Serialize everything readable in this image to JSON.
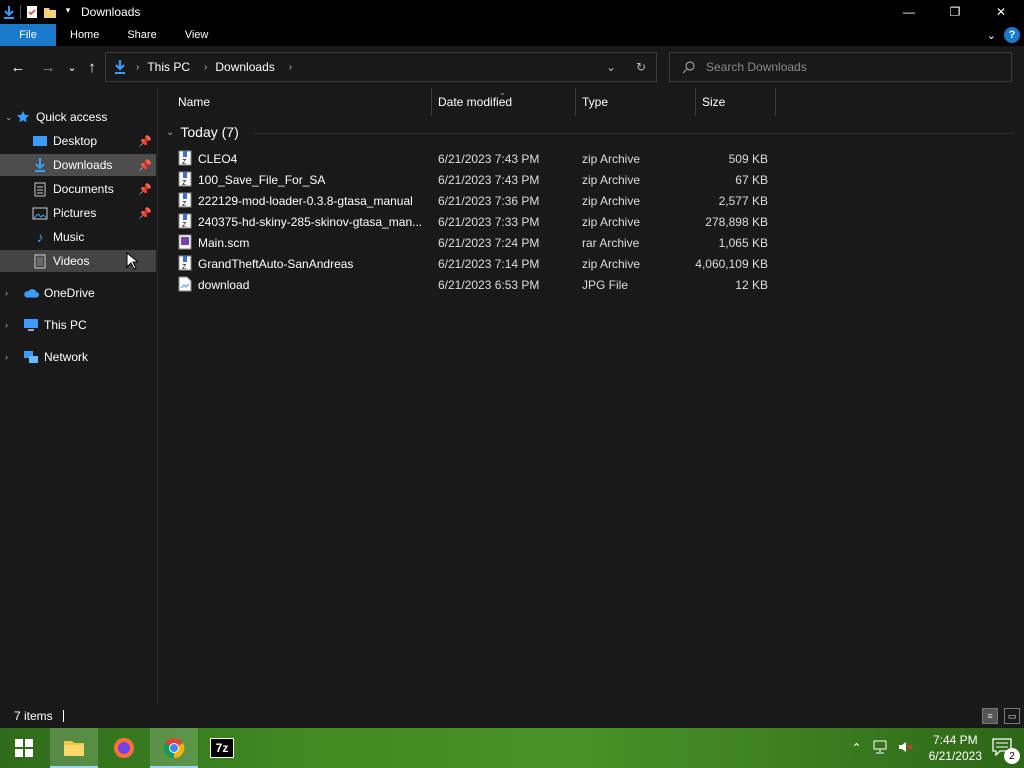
{
  "window": {
    "title": "Downloads",
    "controls": {
      "minimize": "—",
      "restore": "❐",
      "close": "✕"
    }
  },
  "ribbon": {
    "tabs": [
      "File",
      "Home",
      "Share",
      "View"
    ],
    "help": "?"
  },
  "nav": {
    "back": "←",
    "forward": "→",
    "recent": "⌄",
    "up": "↑",
    "breadcrumb": [
      "This PC",
      "Downloads"
    ],
    "search_placeholder": "Search Downloads"
  },
  "sidebar": {
    "items": [
      {
        "label": "Quick access",
        "icon": "star-icon",
        "level": 0,
        "expand": "⌄"
      },
      {
        "label": "Desktop",
        "icon": "desktop-icon",
        "level": 1,
        "pinned": true
      },
      {
        "label": "Downloads",
        "icon": "download-icon",
        "level": 1,
        "pinned": true,
        "selected": true
      },
      {
        "label": "Documents",
        "icon": "documents-icon",
        "level": 1,
        "pinned": true
      },
      {
        "label": "Pictures",
        "icon": "pictures-icon",
        "level": 1,
        "pinned": true
      },
      {
        "label": "Music",
        "icon": "music-icon",
        "level": 1
      },
      {
        "label": "Videos",
        "icon": "videos-icon",
        "level": 1,
        "hover": true
      },
      {
        "label": "OneDrive",
        "icon": "cloud-icon",
        "level": 0,
        "expand": "›"
      },
      {
        "label": "This PC",
        "icon": "computer-icon",
        "level": 0,
        "expand": "›"
      },
      {
        "label": "Network",
        "icon": "network-icon",
        "level": 0,
        "expand": "›"
      }
    ]
  },
  "columns": [
    "Name",
    "Date modified",
    "Type",
    "Size"
  ],
  "group": {
    "label": "Today (7)"
  },
  "files": [
    {
      "name": "CLEO4",
      "date": "6/21/2023 7:43 PM",
      "type": "zip Archive",
      "size": "509 KB",
      "icon": "zip-archive-icon"
    },
    {
      "name": "100_Save_File_For_SA",
      "date": "6/21/2023 7:43 PM",
      "type": "zip Archive",
      "size": "67 KB",
      "icon": "zip-archive-icon"
    },
    {
      "name": "222129-mod-loader-0.3.8-gtasa_manual",
      "date": "6/21/2023 7:36 PM",
      "type": "zip Archive",
      "size": "2,577 KB",
      "icon": "zip-archive-icon"
    },
    {
      "name": "240375-hd-skiny-285-skinov-gtasa_man...",
      "date": "6/21/2023 7:33 PM",
      "type": "zip Archive",
      "size": "278,898 KB",
      "icon": "zip-archive-icon"
    },
    {
      "name": "Main.scm",
      "date": "6/21/2023 7:24 PM",
      "type": "rar Archive",
      "size": "1,065 KB",
      "icon": "rar-archive-icon"
    },
    {
      "name": "GrandTheftAuto-SanAndreas",
      "date": "6/21/2023 7:14 PM",
      "type": "zip Archive",
      "size": "4,060,109 KB",
      "icon": "zip-archive-icon"
    },
    {
      "name": "download",
      "date": "6/21/2023 6:53 PM",
      "type": "JPG File",
      "size": "12 KB",
      "icon": "image-file-icon"
    }
  ],
  "status": {
    "items": "7 items"
  },
  "taskbar": {
    "apps": [
      "start-icon",
      "file-explorer-icon",
      "firefox-icon",
      "chrome-icon",
      "7zip-icon"
    ],
    "seven_zip_label": "7z",
    "time": "7:44 PM",
    "date": "6/21/2023",
    "notifications": "2"
  },
  "colors": {
    "accent": "#1979ca",
    "background": "#191919",
    "selected": "#4d4d4d"
  }
}
